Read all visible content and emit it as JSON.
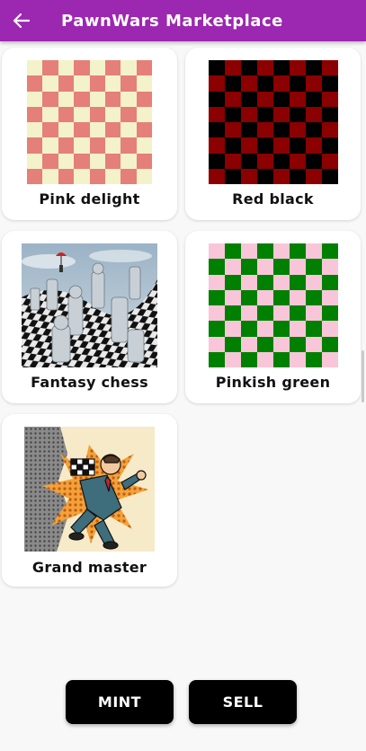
{
  "appbar": {
    "title": "PawnWars Marketplace",
    "back_icon": "arrow-left-icon",
    "color": "#9c27b0"
  },
  "items": [
    {
      "label": "Pink delight",
      "light": "#f4f2c8",
      "dark": "#e57f7a"
    },
    {
      "label": "Red black",
      "light": "#000000",
      "dark": "#8b0000"
    },
    {
      "label": "Fantasy chess"
    },
    {
      "label": "Pinkish green",
      "light": "#f8c6d8",
      "dark": "#008000"
    },
    {
      "label": "Grand master"
    }
  ],
  "buttons": {
    "mint": "MINT",
    "sell": "SELL"
  }
}
